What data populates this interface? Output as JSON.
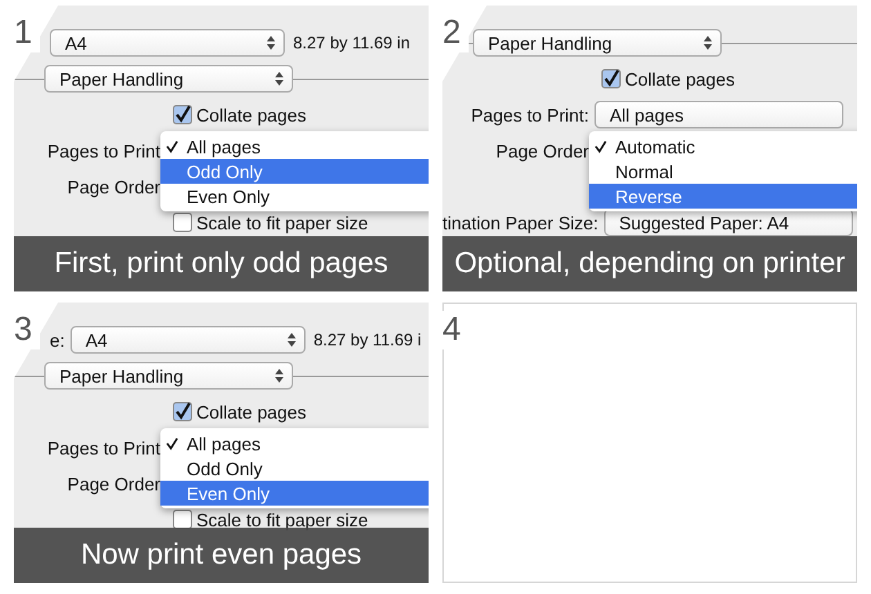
{
  "panels": [
    {
      "number": "1",
      "rows": [
        {
          "kind": "size",
          "value": "A4",
          "note": "8.27 by 11.69 in"
        },
        {
          "kind": "section",
          "value": "Paper Handling"
        },
        {
          "kind": "checkbox",
          "label": "Collate pages",
          "checked": true
        },
        {
          "kind": "field",
          "label": "Pages to Print",
          "menu": [
            {
              "label": "All pages",
              "checked": true,
              "selected": false
            },
            {
              "label": "Odd Only",
              "checked": false,
              "selected": true
            },
            {
              "label": "Even Only",
              "checked": false,
              "selected": false
            }
          ]
        },
        {
          "kind": "field",
          "label": "Page Order"
        },
        {
          "kind": "checkbox",
          "label": "Scale to fit paper size",
          "checked": false
        }
      ],
      "caption": "First, print only odd pages"
    },
    {
      "number": "2",
      "rows": [
        {
          "kind": "section",
          "value": "Paper Handling"
        },
        {
          "kind": "checkbox",
          "label": "Collate pages",
          "checked": true
        },
        {
          "kind": "field",
          "label": "Pages to Print:",
          "value": "All pages"
        },
        {
          "kind": "field",
          "label": "Page Order",
          "menu": [
            {
              "label": "Automatic",
              "checked": true,
              "selected": false
            },
            {
              "label": "Normal",
              "checked": false,
              "selected": false
            },
            {
              "label": "Reverse",
              "checked": false,
              "selected": true
            }
          ]
        },
        {
          "kind": "field",
          "label": "tination Paper Size:",
          "value": "Suggested Paper: A4"
        }
      ],
      "caption": "Optional, depending on printer"
    },
    {
      "number": "3",
      "rows": [
        {
          "kind": "size",
          "label": "e:",
          "value": "A4",
          "note": "8.27 by 11.69 i"
        },
        {
          "kind": "section",
          "value": "Paper Handling"
        },
        {
          "kind": "checkbox",
          "label": "Collate pages",
          "checked": true
        },
        {
          "kind": "field",
          "label": "Pages to Print",
          "menu": [
            {
              "label": "All pages",
              "checked": true,
              "selected": false
            },
            {
              "label": "Odd Only",
              "checked": false,
              "selected": false
            },
            {
              "label": "Even Only",
              "checked": false,
              "selected": true
            }
          ]
        },
        {
          "kind": "field",
          "label": "Page Order"
        },
        {
          "kind": "checkbox",
          "label": "Scale to fit paper size",
          "checked": false
        }
      ],
      "caption": "Now print even pages"
    },
    {
      "number": "4"
    }
  ]
}
